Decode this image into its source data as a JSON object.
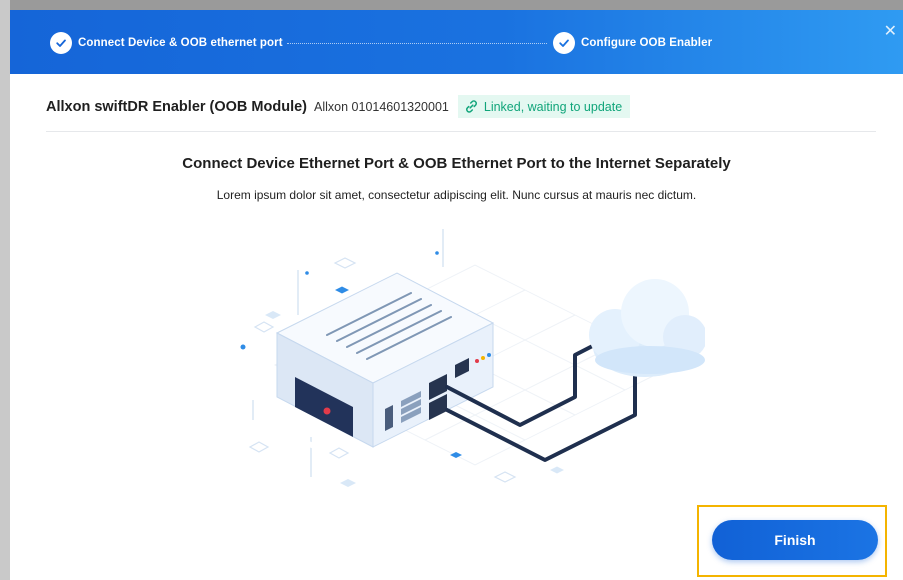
{
  "stepper": {
    "steps": [
      {
        "label": "Connect Device & OOB ethernet port",
        "state": "complete"
      },
      {
        "label": "Configure OOB Enabler",
        "state": "complete"
      }
    ]
  },
  "close_icon": "close-icon",
  "device": {
    "name": "Allxon swiftDR Enabler (OOB Module)",
    "serial": "Allxon 01014601320001",
    "status": "Linked, waiting to update",
    "status_icon": "link-icon"
  },
  "content": {
    "title": "Connect Device Ethernet Port & OOB Ethernet Port to the Internet Separately",
    "description": "Lorem ipsum dolor sit amet, consectetur adipiscing elit. Nunc cursus at mauris nec dictum."
  },
  "footer": {
    "finish_label": "Finish"
  },
  "colors": {
    "header_start": "#1565d8",
    "header_end": "#2f9bf2",
    "status_green": "#11a57a",
    "status_bg": "#e4f8f1",
    "primary_button": "#1161d6",
    "highlight": "#f4b400"
  }
}
